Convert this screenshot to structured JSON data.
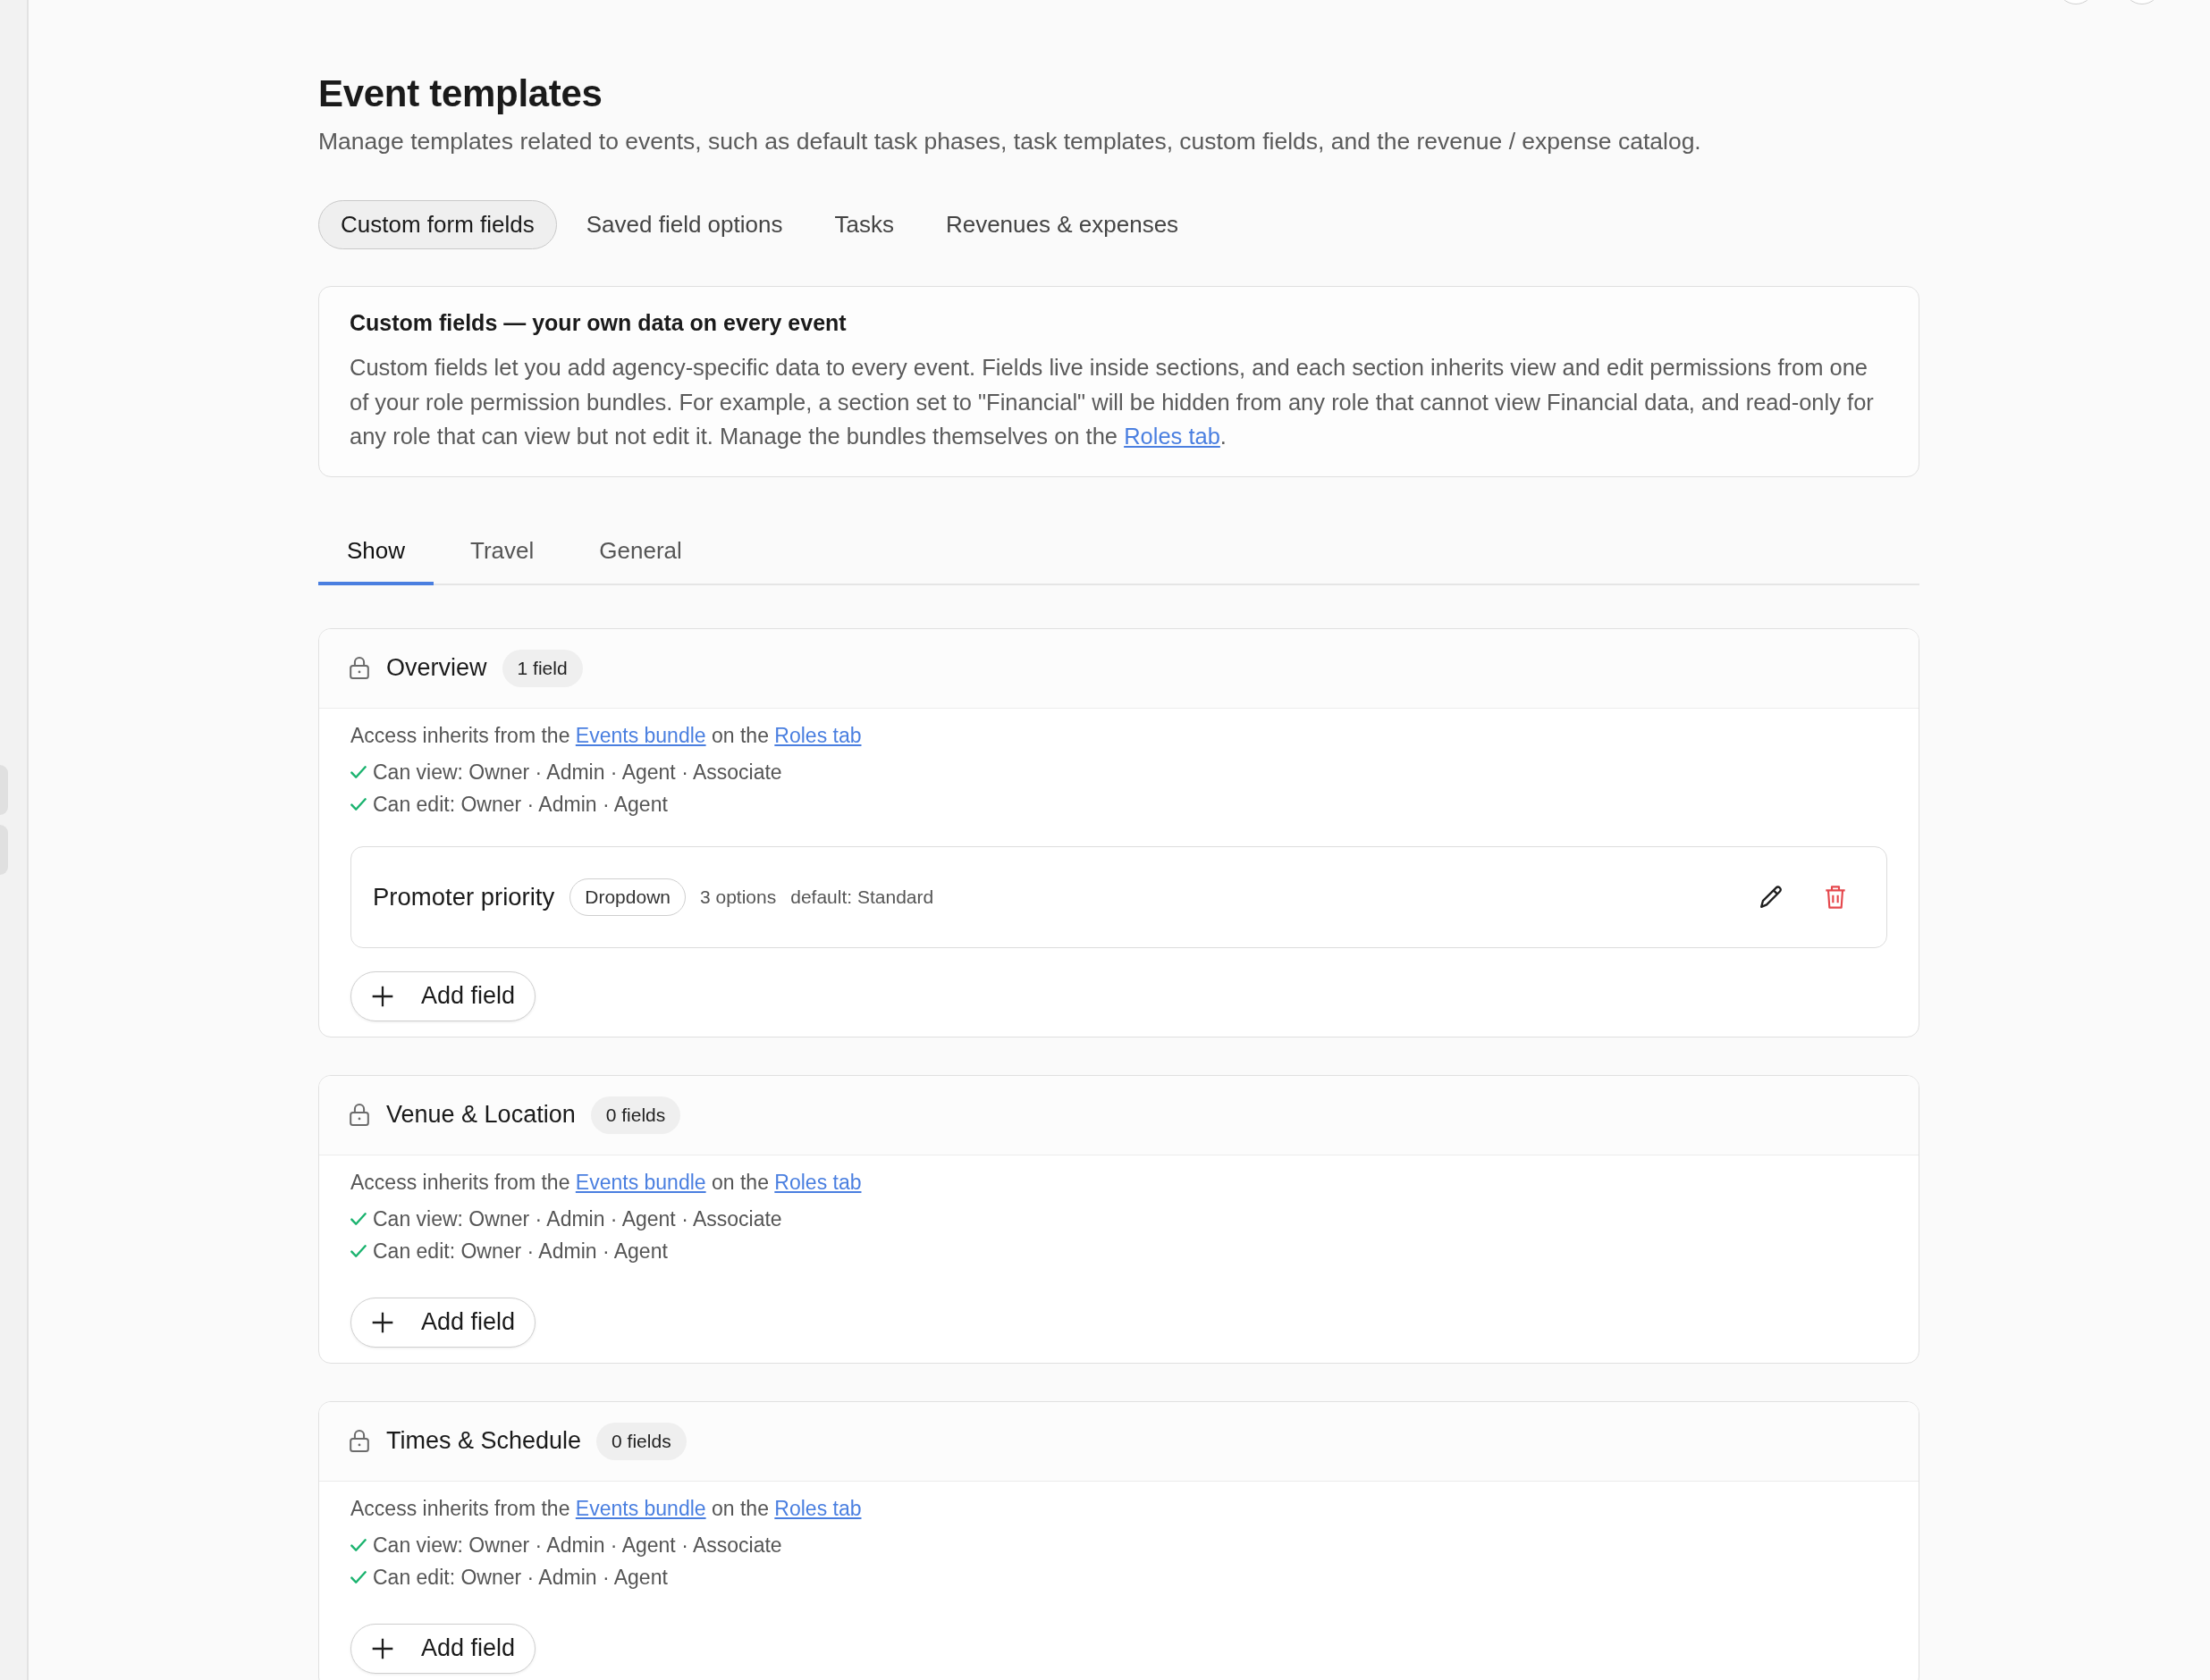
{
  "header": {
    "title": "Event templates",
    "description": "Manage templates related to events, such as default task phases, task templates, custom fields, and the revenue / expense catalog."
  },
  "tabs": [
    {
      "label": "Custom form fields",
      "selected": true
    },
    {
      "label": "Saved field options",
      "selected": false
    },
    {
      "label": "Tasks",
      "selected": false
    },
    {
      "label": "Revenues & expenses",
      "selected": false
    }
  ],
  "info_card": {
    "title": "Custom fields — your own data on every event",
    "text": [
      {
        "kind": "text",
        "text": "Custom fields let you add agency-specific data to every event. Fields live inside sections, and each section inherits view and edit permissions from one of your role permission bundles. For example, a section set to \"Financial\" will be hidden from any role that cannot view Financial data, and read-only for any role that can view but not edit it. Manage the bundles themselves on the "
      },
      {
        "kind": "link",
        "text": "Roles tab"
      },
      {
        "kind": "text",
        "text": "."
      }
    ]
  },
  "section_tabs": [
    {
      "label": "Show",
      "selected": true
    },
    {
      "label": "Travel",
      "selected": false
    },
    {
      "label": "General",
      "selected": false
    }
  ],
  "sections": [
    {
      "title": "Overview",
      "count": "1 field",
      "access": [
        {
          "kind": "text",
          "text": "Access inherits from the "
        },
        {
          "kind": "link",
          "text": "Events bundle"
        },
        {
          "kind": "text",
          "text": " on the "
        },
        {
          "kind": "link",
          "text": "Roles tab"
        }
      ],
      "permissions": [
        "Can view: Owner · Admin · Agent · Associate",
        "Can edit: Owner · Admin · Agent"
      ],
      "fields": [
        {
          "name": "Promoter priority",
          "type": "Dropdown",
          "options": "3 options",
          "default": "default: Standard"
        }
      ],
      "add_label": "Add field"
    },
    {
      "title": "Venue & Location",
      "count": "0 fields",
      "access": [
        {
          "kind": "text",
          "text": "Access inherits from the "
        },
        {
          "kind": "link",
          "text": "Events bundle"
        },
        {
          "kind": "text",
          "text": " on the "
        },
        {
          "kind": "link",
          "text": "Roles tab"
        }
      ],
      "permissions": [
        "Can view: Owner · Admin · Agent · Associate",
        "Can edit: Owner · Admin · Agent"
      ],
      "add_label": "Add field"
    },
    {
      "title": "Times & Schedule",
      "count": "0 fields",
      "access": [
        {
          "kind": "text",
          "text": "Access inherits from the "
        },
        {
          "kind": "link",
          "text": "Events bundle"
        },
        {
          "kind": "text",
          "text": " on the "
        },
        {
          "kind": "link",
          "text": "Roles tab"
        }
      ],
      "permissions": [
        "Can view: Owner · Admin · Agent · Associate",
        "Can edit: Owner · Admin · Agent"
      ],
      "add_label": "Add field"
    }
  ]
}
